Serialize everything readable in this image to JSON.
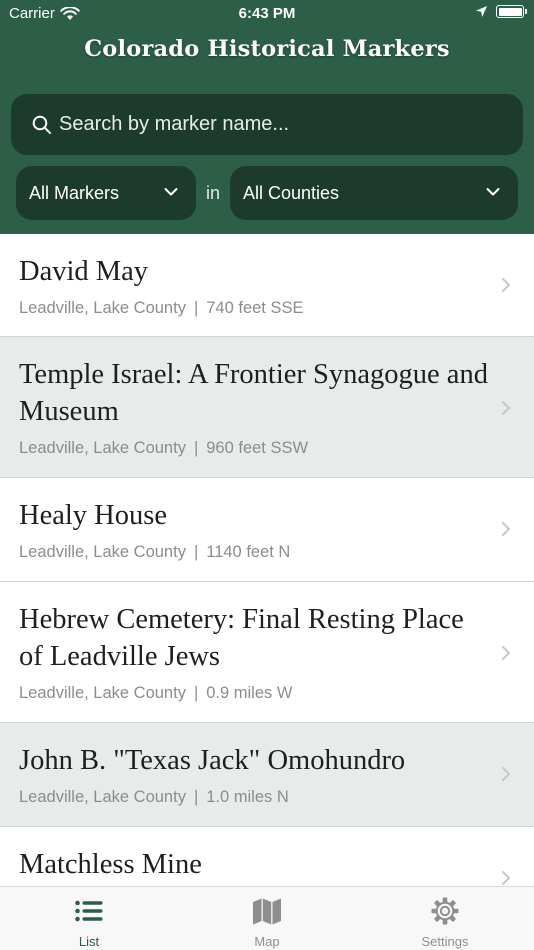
{
  "status_bar": {
    "carrier": "Carrier",
    "time": "6:43 PM"
  },
  "header": {
    "title": "Colorado Historical Markers",
    "background_color": "#2d5e48",
    "control_color": "#1d3b2d"
  },
  "search": {
    "placeholder": "Search by marker name...",
    "value": ""
  },
  "filters": {
    "marker_type": "All Markers",
    "connector": "in",
    "county": "All Counties"
  },
  "markers": [
    {
      "name": "David May",
      "location": "Leadville, Lake County",
      "distance": "740 feet SSE"
    },
    {
      "name": "Temple Israel: A Frontier Synagogue and Museum",
      "location": "Leadville, Lake County",
      "distance": "960 feet SSW"
    },
    {
      "name": "Healy House",
      "location": "Leadville, Lake County",
      "distance": "1140 feet N"
    },
    {
      "name": "Hebrew Cemetery: Final Resting Place of Leadville Jews",
      "location": "Leadville, Lake County",
      "distance": "0.9 miles W"
    },
    {
      "name": "John B. \"Texas Jack\" Omohundro",
      "location": "Leadville, Lake County",
      "distance": "1.0 miles N"
    },
    {
      "name": "Matchless Mine",
      "location": "",
      "distance": ""
    }
  ],
  "tabs": [
    {
      "label": "List",
      "icon": "list-icon",
      "active": true
    },
    {
      "label": "Map",
      "icon": "map-icon",
      "active": false
    },
    {
      "label": "Settings",
      "icon": "gear-icon",
      "active": false
    }
  ],
  "colors": {
    "accent": "#2d5e48",
    "alt_row": "#e7ecea",
    "subtitle": "#8c8c8c",
    "inactive_tab": "#8e8e8e"
  }
}
